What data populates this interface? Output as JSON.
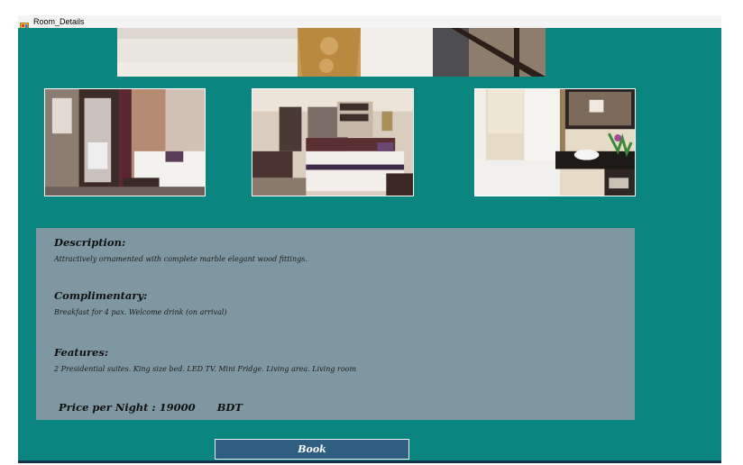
{
  "window": {
    "title": "Room_Details"
  },
  "details": {
    "description_heading": "Description:",
    "description_text": "Attractively ornamented with complete marble  elegant wood fittings.",
    "complimentary_heading": "Complimentary:",
    "complimentary_text": "Breakfast for 4 pax. Welcome drink (on arrival)",
    "features_heading": "Features:",
    "features_text": "2 Presidential suites. King size bed. LED TV. Mini Fridge. Living area. Living room",
    "price_label": "Price per Night : 19000",
    "price_currency": "BDT"
  },
  "actions": {
    "book_label": "Book"
  },
  "colors": {
    "form_background": "#0a8580",
    "details_panel": "#7f97a0",
    "book_button": "#2e5f80"
  },
  "images": {
    "banner": "bed-closeup-photo",
    "photo1": "hotel-room-mirror-photo",
    "photo2": "hotel-bedroom-photo",
    "photo3": "bathroom-bathtub-photo"
  }
}
